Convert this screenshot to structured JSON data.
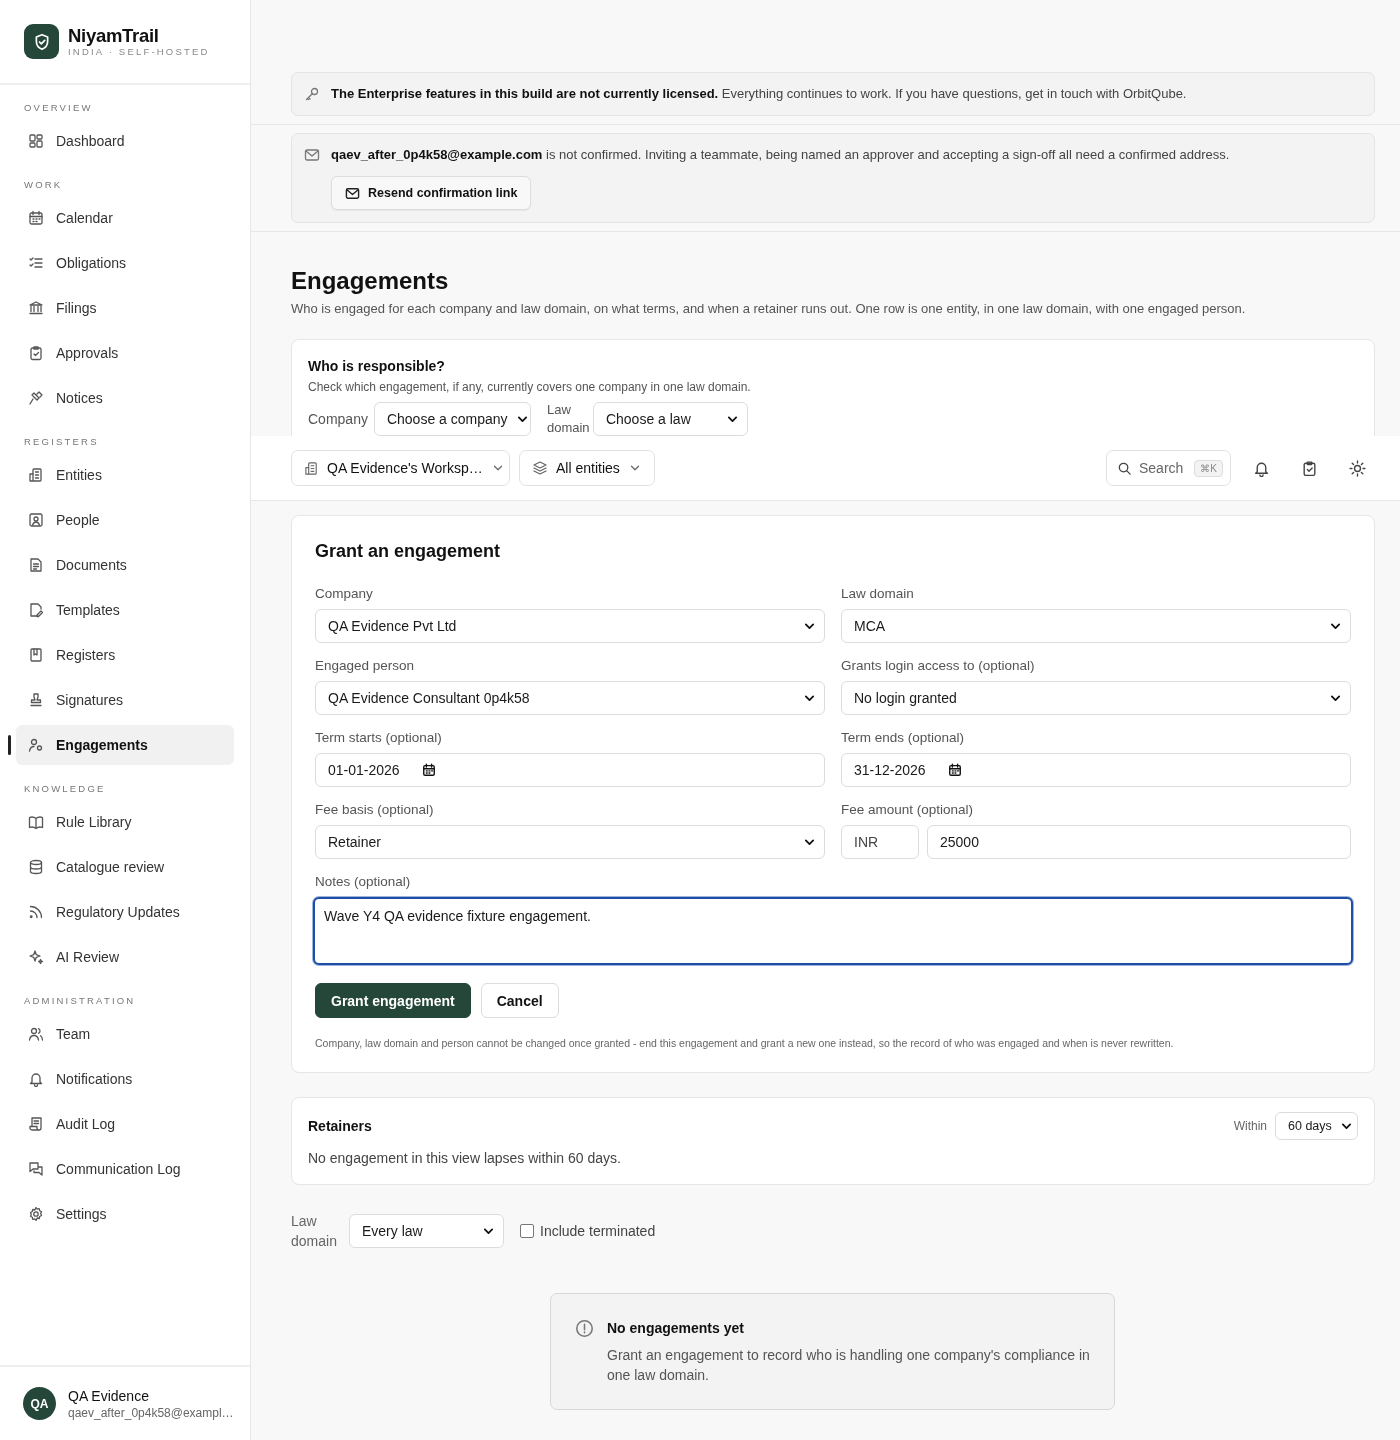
{
  "brand": {
    "name": "NiyamTrail",
    "tagline": "INDIA · SELF-HOSTED"
  },
  "sidebar": {
    "sections": [
      {
        "heading": "OVERVIEW",
        "items": [
          {
            "label": "Dashboard",
            "selected": false
          }
        ]
      },
      {
        "heading": "WORK",
        "items": [
          {
            "label": "Calendar",
            "selected": false
          },
          {
            "label": "Obligations",
            "selected": false
          },
          {
            "label": "Filings",
            "selected": false
          },
          {
            "label": "Approvals",
            "selected": false
          },
          {
            "label": "Notices",
            "selected": false
          }
        ]
      },
      {
        "heading": "REGISTERS",
        "items": [
          {
            "label": "Entities",
            "selected": false
          },
          {
            "label": "People",
            "selected": false
          },
          {
            "label": "Documents",
            "selected": false
          },
          {
            "label": "Templates",
            "selected": false
          },
          {
            "label": "Registers",
            "selected": false
          },
          {
            "label": "Signatures",
            "selected": false
          },
          {
            "label": "Engagements",
            "selected": true
          }
        ]
      },
      {
        "heading": "KNOWLEDGE",
        "items": [
          {
            "label": "Rule Library",
            "selected": false
          },
          {
            "label": "Catalogue review",
            "selected": false
          },
          {
            "label": "Regulatory Updates",
            "selected": false
          },
          {
            "label": "AI Review",
            "selected": false
          }
        ]
      },
      {
        "heading": "ADMINISTRATION",
        "items": [
          {
            "label": "Team",
            "selected": false
          },
          {
            "label": "Notifications",
            "selected": false
          },
          {
            "label": "Audit Log",
            "selected": false
          },
          {
            "label": "Communication Log",
            "selected": false
          },
          {
            "label": "Settings",
            "selected": false
          }
        ]
      }
    ]
  },
  "user": {
    "initials": "QA",
    "name": "QA Evidence",
    "email": "qaev_after_0p4k58@exampl…"
  },
  "banners": [
    {
      "kind": "license",
      "text": "**The Enterprise features in this build are not currently licensed.** Everything continues to work. If you have questions, get in touch with OrbitQube."
    },
    {
      "kind": "email",
      "text": "**qaev_after_0p4k58@example.com** is not confirmed. Inviting a teammate, being named an approver and accepting a sign-off all need a confirmed address.",
      "button": "Resend confirmation link"
    }
  ],
  "page": {
    "title": "Engagements",
    "description": "Who is engaged for each company and law domain, on what terms, and when a retainer runs out. One row is one entity, in one law domain, with one engaged person."
  },
  "responsible": {
    "title": "Who is responsible?",
    "hint": "Check which engagement, if any, currently covers one company in one law domain.",
    "company_label": "Company",
    "company_value": "Choose a company",
    "law_label": "Law domain",
    "law_value": "Choose a law"
  },
  "topbar": {
    "workspace": "QA Evidence's Worksp…",
    "scope": "All entities",
    "search": {
      "placeholder": "Search",
      "shortcut": "⌘K"
    }
  },
  "form": {
    "title": "Grant an engagement",
    "fields": [
      {
        "label": "Company",
        "kind": "select",
        "value": "QA Evidence Pvt Ltd",
        "focused": false
      },
      {
        "label": "Law domain",
        "kind": "select",
        "value": "MCA",
        "focused": false
      },
      {
        "label": "Engaged person",
        "kind": "select",
        "value": "QA Evidence Consultant 0p4k58",
        "focused": false
      },
      {
        "label": "Grants login access to (optional)",
        "kind": "select",
        "value": "No login granted",
        "focused": false
      },
      {
        "label": "Term starts (optional)",
        "kind": "date",
        "value": "01-01-2026",
        "focused": false
      },
      {
        "label": "Term ends (optional)",
        "kind": "date",
        "value": "31-12-2026",
        "focused": false
      },
      {
        "label": "Fee basis (optional)",
        "kind": "select",
        "value": "Retainer",
        "focused": false
      },
      {
        "label": "Fee amount (optional)",
        "kind": "currency",
        "currency": "INR",
        "value": "25000",
        "focused": false
      },
      {
        "label": "Notes (optional)",
        "kind": "textarea",
        "value": "Wave Y4 QA evidence fixture engagement.",
        "focused": true
      }
    ],
    "buttons": [
      {
        "label": "Grant engagement",
        "primary": true
      },
      {
        "label": "Cancel",
        "primary": false
      }
    ],
    "footnote": "Company, law domain and person cannot be changed once granted - end this engagement and grant a new one instead, so the record of who was engaged and when is never rewritten."
  },
  "retainers": {
    "title": "Retainers",
    "within_label": "Within",
    "within_value": "60 days",
    "message": "No engagement in this view lapses within 60 days."
  },
  "filters": {
    "law_label": "Law domain",
    "law_value": "Every law",
    "include_terminated": {
      "label": "Include terminated",
      "checked": false
    }
  },
  "empty_state": {
    "title": "No engagements yet",
    "text": "Grant an engagement to record who is handling one company's compliance in one law domain."
  }
}
